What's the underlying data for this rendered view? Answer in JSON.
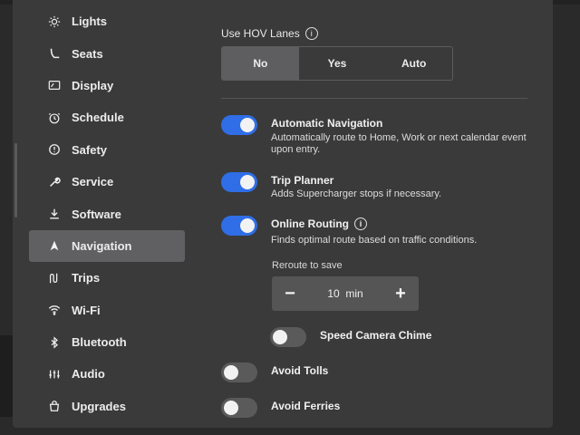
{
  "sidebar": {
    "items": [
      {
        "label": "Lights",
        "icon": "sun-icon"
      },
      {
        "label": "Seats",
        "icon": "seat-icon"
      },
      {
        "label": "Display",
        "icon": "display-icon"
      },
      {
        "label": "Schedule",
        "icon": "clock-icon"
      },
      {
        "label": "Safety",
        "icon": "alert-circle-icon"
      },
      {
        "label": "Service",
        "icon": "wrench-icon"
      },
      {
        "label": "Software",
        "icon": "download-icon"
      },
      {
        "label": "Navigation",
        "icon": "navigation-arrow-icon",
        "active": true
      },
      {
        "label": "Trips",
        "icon": "trips-icon"
      },
      {
        "label": "Wi-Fi",
        "icon": "wifi-icon"
      },
      {
        "label": "Bluetooth",
        "icon": "bluetooth-icon"
      },
      {
        "label": "Audio",
        "icon": "equalizer-icon"
      },
      {
        "label": "Upgrades",
        "icon": "bag-icon"
      }
    ]
  },
  "hov": {
    "label": "Use HOV Lanes",
    "options": [
      "No",
      "Yes",
      "Auto"
    ],
    "selected": "No"
  },
  "options": {
    "auto_nav": {
      "title": "Automatic Navigation",
      "desc": "Automatically route to Home, Work or next calendar event upon entry.",
      "on": true
    },
    "trip_planner": {
      "title": "Trip Planner",
      "desc": "Adds Supercharger stops if necessary.",
      "on": true
    },
    "online_routing": {
      "title": "Online Routing",
      "desc": "Finds optimal route based on traffic conditions.",
      "on": true
    },
    "speed_camera": {
      "title": "Speed Camera Chime",
      "on": false
    },
    "avoid_tolls": {
      "title": "Avoid Tolls",
      "on": false
    },
    "avoid_ferries": {
      "title": "Avoid Ferries",
      "on": false
    }
  },
  "reroute": {
    "label": "Reroute to save",
    "value": "10  min",
    "minus": "−",
    "plus": "+"
  },
  "colors": {
    "toggle_on": "#2f6ee6",
    "selected_segment": "#5e5e60",
    "active_nav": "#606062"
  }
}
